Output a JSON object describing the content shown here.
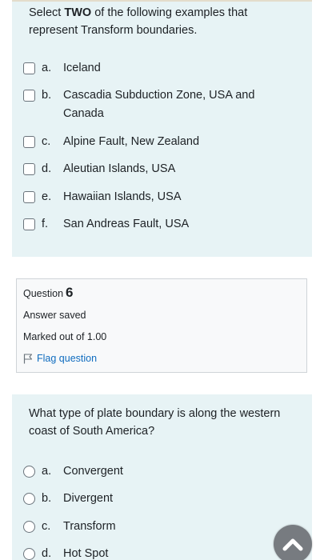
{
  "question5": {
    "prompt_before": "Select ",
    "prompt_bold": "TWO",
    "prompt_after": " of the following examples that represent Transform boundaries.",
    "answers": [
      {
        "letter": "a.",
        "label": "Iceland"
      },
      {
        "letter": "b.",
        "label": "Cascadia Subduction Zone, USA and Canada"
      },
      {
        "letter": "c.",
        "label": "Alpine Fault, New Zealand"
      },
      {
        "letter": "d.",
        "label": "Aleutian Islands, USA"
      },
      {
        "letter": "e.",
        "label": "Hawaiian Islands, USA"
      },
      {
        "letter": "f.",
        "label": "San Andreas Fault, USA"
      }
    ]
  },
  "question6": {
    "info": {
      "question_label": "Question",
      "number": "6",
      "state": "Answer saved",
      "grade": "Marked out of 1.00",
      "flag_label": "Flag question"
    },
    "prompt": "What type of plate boundary is along the western coast of South America?",
    "answers": [
      {
        "letter": "a.",
        "label": "Convergent"
      },
      {
        "letter": "b.",
        "label": "Divergent"
      },
      {
        "letter": "c.",
        "label": "Transform"
      },
      {
        "letter": "d.",
        "label": "Hot Spot"
      }
    ]
  },
  "icons": {
    "flag": "flag-icon",
    "scroll_top": "chevron-up-icon"
  },
  "colors": {
    "panel_bg": "#e7f3f5",
    "link": "#0f6cbf",
    "scroll_button": "#777b80"
  }
}
